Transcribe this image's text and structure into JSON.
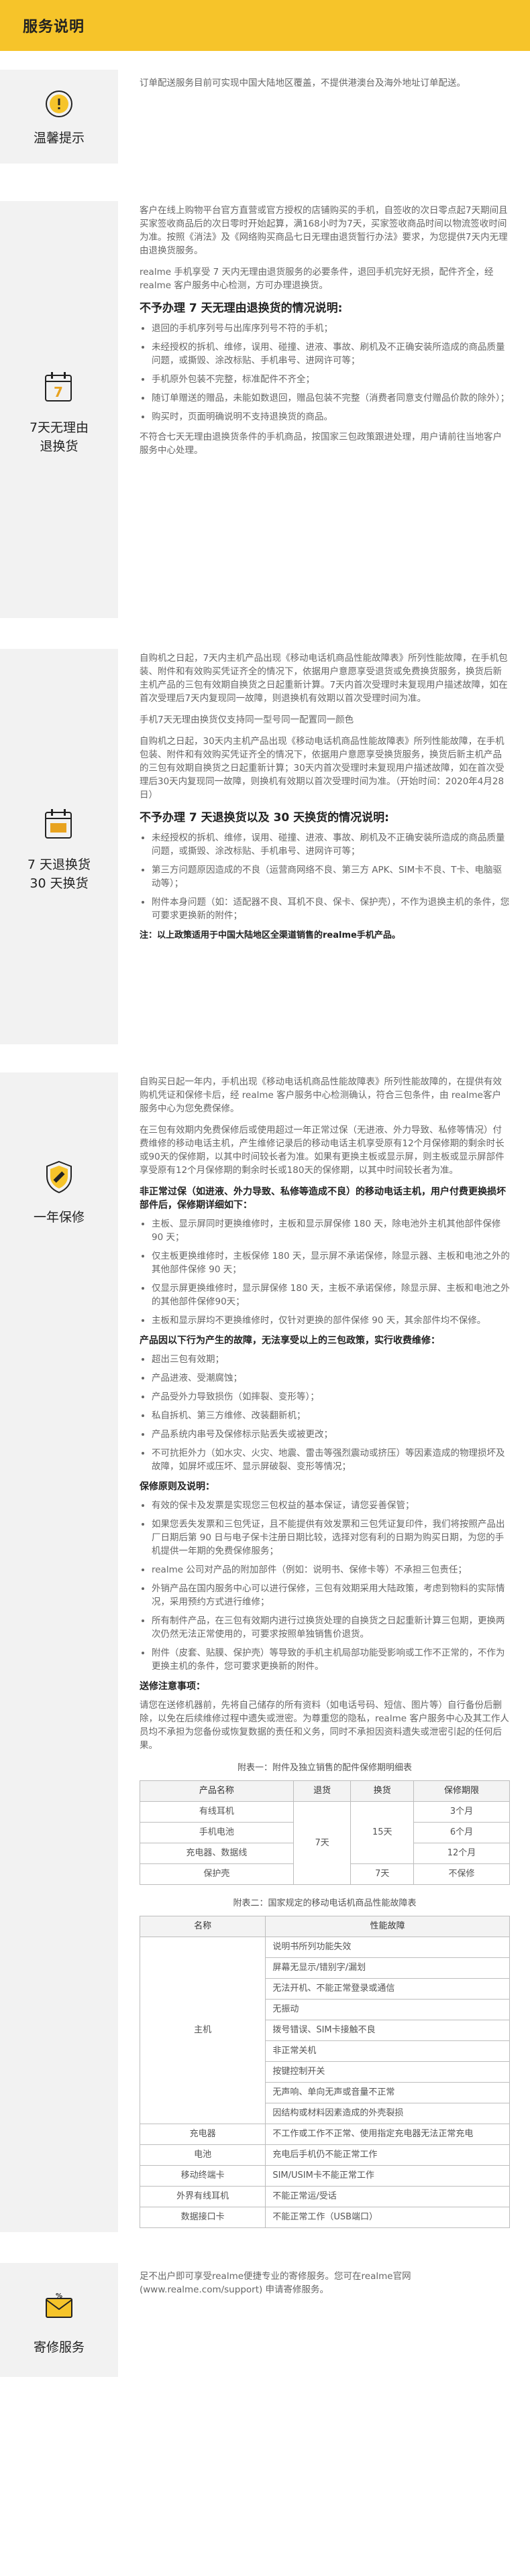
{
  "header": {
    "title": "服务说明"
  },
  "tips": {
    "label": "温馨提示",
    "text": "订单配送服务目前可实现中国大陆地区覆盖，不提供港澳台及海外地址订单配送。"
  },
  "return7": {
    "label": "7天无理由退换货",
    "p1": "客户在线上购物平台官方直营或官方授权的店铺购买的手机，自签收的次日零点起7天期间且买家签收商品后的次日零时开始起算，满168小时为7天，买家签收商品时间以物流签收时间为准。按照《消法》及《网络购买商品七日无理由退货暂行办法》要求，为您提供7天内无理由退换货服务。",
    "p2": "realme 手机享受 7 天内无理由退货服务的必要条件，退回手机完好无损，配件齐全，经 realme 客户服务中心检测，方可办理退换货。",
    "heading": "不予办理 7 天无理由退换货的情况说明:",
    "items": [
      "退回的手机序列号与出库序列号不符的手机；",
      "未经授权的拆机、维修，误用、碰撞、进液、事故、刷机及不正确安装所造成的商品质量问题，或撕毁、涂改标贴、手机串号、进网许可等；",
      "手机原外包装不完整，标准配件不齐全；",
      "随订单赠送的赠品，未能如数退回，赠品包装不完整（消费者同意支付赠品价款的除外）；",
      "购买时，页面明确说明不支持退换货的商品。"
    ],
    "p3": "不符合七天无理由退换货条件的手机商品，按国家三包政策跟进处理，用户请前往当地客户服务中心处理。"
  },
  "exchange": {
    "label1": "7 天退换货",
    "label2": "30 天换货",
    "p1": "自购机之日起，7天内主机产品出现《移动电话机商品性能故障表》所列性能故障，在手机包装、附件和有效购买凭证齐全的情况下，依据用户意愿享受退货或免费换货服务，换货后新主机产品的三包有效期自换货之日起重新计算。7天内首次受理时未复现用户描述故障，如在首次受理后7天内复现同一故障，则退换机有效期以首次受理时间为准。",
    "p2": "手机7天无理由换货仅支持同一型号同一配置同一颜色",
    "p3": "自购机之日起，30天内主机产品出现《移动电话机商品性能故障表》所列性能故障，在手机包装、附件和有效购买凭证齐全的情况下，依据用户意愿享受换货服务，换货后新主机产品的三包有效期自换货之日起重新计算；30天内首次受理时未复现用户描述故障，如在首次受理后30天内复现同一故障，则换机有效期以首次受理时间为准。（开始时间：2020年4月28日）",
    "heading": "不予办理 7 天退换货以及 30 天换货的情况说明:",
    "items": [
      "未经授权的拆机、维修，误用、碰撞、进液、事故、刷机及不正确安装所造成的商品质量问题，或撕毁、涂改标贴、手机串号、进网许可等；",
      "第三方问题原因造成的不良（运营商网络不良、第三方 APK、SIM卡不良、T卡、电脑驱动等）；",
      "附件本身问题（如：适配器不良、耳机不良、保卡、保护壳），不作为退换主机的条件，您可要求更换新的附件；"
    ],
    "note": "注：以上政策适用于中国大陆地区全渠道销售的realme手机产品。"
  },
  "warranty": {
    "label": "一年保修",
    "p1": "自购买日起一年内，手机出现《移动电话机商品性能故障表》所列性能故障的，在提供有效购机凭证和保修卡后，经 realme 客户服务中心检测确认，符合三包条件，由 realme客户服务中心为您免费保修。",
    "p2": "在三包有效期内免费保修后或使用超过一年正常过保（无进液、外力导致、私修等情况）付费维修的移动电话主机，产生维修记录后的移动电话主机享受原有12个月保修期的剩余时长或90天的保修期，以其中时间较长者为准。如果有更换主板或显示屏，则主板或显示屏部件享受原有12个月保修期的剩余时长或180天的保修期，以其中时间较长者为准。",
    "q1": "非正常过保（如进液、外力导致、私修等造成不良）的移动电话主机，用户付费更换损坏部件后，保修期详细如下：",
    "q1items": [
      "主板、显示屏同时更换维修时，主板和显示屏保修 180 天，除电池外主机其他部件保修 90 天；",
      "仅主板更换维修时，主板保修 180 天，显示屏不承诺保修，除显示器、主板和电池之外的其他部件保修 90 天；",
      "仅显示屏更换维修时，显示屏保修 180 天，主板不承诺保修，除显示屏、主板和电池之外的其他部件保修90天；",
      "主板和显示屏均不更换维修时，仅针对更换的部件保修 90 天，其余部件均不保修。"
    ],
    "q2": "产品因以下行为产生的故障，无法享受以上的三包政策，实行收费维修：",
    "q2items": [
      "超出三包有效期；",
      "产品进液、受潮腐蚀；",
      "产品受外力导致损伤（如摔裂、变形等）；",
      "私自拆机、第三方维修、改装翻新机；",
      "产品系统内串号及保修标示贴丢失或被更改；",
      "不可抗拒外力（如水灾、火灾、地震、雷击等强烈震动或挤压）等因素造成的物理损坏及故障，如屏坏或压坏、显示屏破裂、变形等情况；"
    ],
    "q3": "保修原则及说明：",
    "q3items": [
      "有效的保卡及发票是实现您三包权益的基本保证，请您妥善保管；",
      "如果您丢失发票和三包凭证，且不能提供有效发票和三包凭证复印件，我们将按照产品出厂日期后第 90 日与电子保卡注册日期比较，选择对您有利的日期为购买日期，为您的手机提供一年期的免费保修服务；",
      "realme 公司对产品的附加部件（例如：说明书、保修卡等）不承担三包责任；",
      "外销产品在国内服务中心可以进行保修，三包有效期采用大陆政策，考虑到物料的实际情况，采用预约方式进行维修；",
      "所有制件产品，在三包有效期内进行过换货处理的自换货之日起重新计算三包期，更换两次仍然无法正常使用的，可要求按照单独销售价退货。",
      "附件（皮套、贴膜、保护壳）等导致的手机主机局部功能受影响或工作不正常的，不作为更换主机的条件，您可要求更换新的附件。"
    ],
    "q4": "送修注意事项：",
    "q4text": "请您在送修机器前，先将自己储存的所有资料（如电话号码、短信、图片等）自行备份后删除，以免在后续维修过程中遗失或泄密。为尊重您的隐私，realme 客户服务中心及其工作人员均不承担为您备份或恢复数据的责任和义务，同时不承担因资料遗失或泄密引起的任何后果。",
    "table1": {
      "caption": "附表一：附件及独立销售的配件保修期明细表",
      "headers": [
        "产品名称",
        "退货",
        "换货",
        "保修期限"
      ],
      "rows": [
        [
          "有线耳机",
          "3个月"
        ],
        [
          "手机电池",
          "6个月"
        ],
        [
          "充电器、数据线",
          "12个月"
        ],
        [
          "保护壳",
          "7天",
          "不保修"
        ]
      ],
      "return_days": "7天",
      "exchange_days": "15天"
    },
    "table2": {
      "caption": "附表二：国家规定的移动电话机商品性能故障表",
      "headers": [
        "名称",
        "性能故障"
      ],
      "main_name": "主机",
      "main_faults": [
        "说明书所列功能失效",
        "屏幕无显示/错别字/漏划",
        "无法开机、不能正常登录或通信",
        "无振动",
        "拨号错误、SIM卡接触不良",
        "非正常关机",
        "按键控制开关",
        "无声响、单向无声或音量不正常",
        "因结构或材料因素造成的外壳裂损"
      ],
      "others": [
        [
          "充电器",
          "不工作或工作不正常、使用指定充电器无法正常充电"
        ],
        [
          "电池",
          "充电后手机仍不能正常工作"
        ],
        [
          "移动终端卡",
          "SIM/USIM卡不能正常工作"
        ],
        [
          "外界有线耳机",
          "不能正常运/受话"
        ],
        [
          "数据接口卡",
          "不能正常工作（USB端口）"
        ]
      ]
    }
  },
  "repair": {
    "label": "寄修服务",
    "text": "足不出户即可享受realme便捷专业的寄修服务。您可在realme官网(www.realme.com/support) 申请寄修服务。"
  },
  "colors": {
    "header_bg": "#f6c42a",
    "side_bg": "#f2f2f2",
    "icon_color": "#e8a320"
  },
  "icons": [
    "info-icon",
    "calendar-7-icon",
    "calendar-30-icon",
    "shield-wrench-icon",
    "mail-percent-icon"
  ]
}
